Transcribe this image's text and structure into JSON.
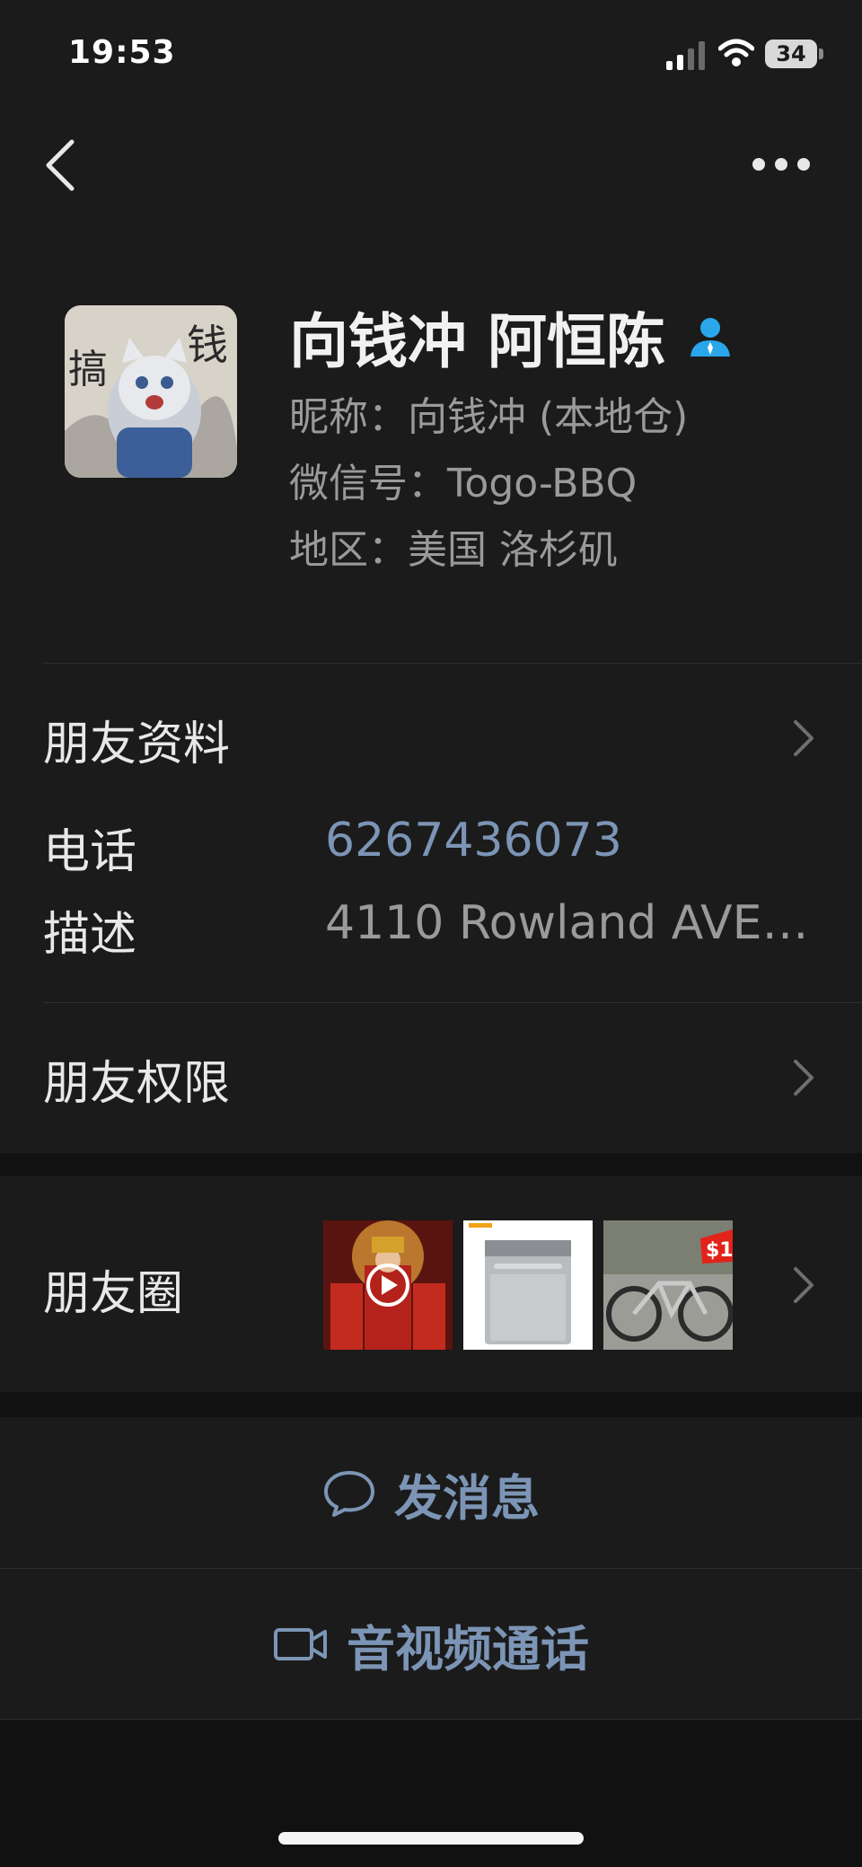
{
  "status_bar": {
    "time": "19:53",
    "battery": "34",
    "icons": [
      "signal-icon",
      "wifi-icon",
      "battery-icon"
    ]
  },
  "nav": {
    "icons": [
      "back-arrow-icon",
      "more-icon"
    ]
  },
  "profile": {
    "display_name": "向钱冲 阿恒陈",
    "nickname": "昵称：向钱冲 (本地仓)",
    "wechat_id": "微信号：Togo-BBQ",
    "region": "地区：美国 洛杉矶",
    "avatar_text": "搞钱",
    "badge_icon": "person-star-icon"
  },
  "friend_info": {
    "label": "朋友资料",
    "phone_label": "电话",
    "phone_value": "6267436073",
    "desc_label": "描述",
    "desc_value": "4110 Rowland  AVE,..."
  },
  "permissions": {
    "label": "朋友权限"
  },
  "moments": {
    "label": "朋友圈",
    "thumb_bike_text": "$1"
  },
  "actions": {
    "message": "发消息",
    "call": "音视频通话"
  },
  "colors": {
    "background": "#1b1b1b",
    "gap": "#111111",
    "link": "#7c95b6",
    "badge": "#2aa7ea"
  }
}
